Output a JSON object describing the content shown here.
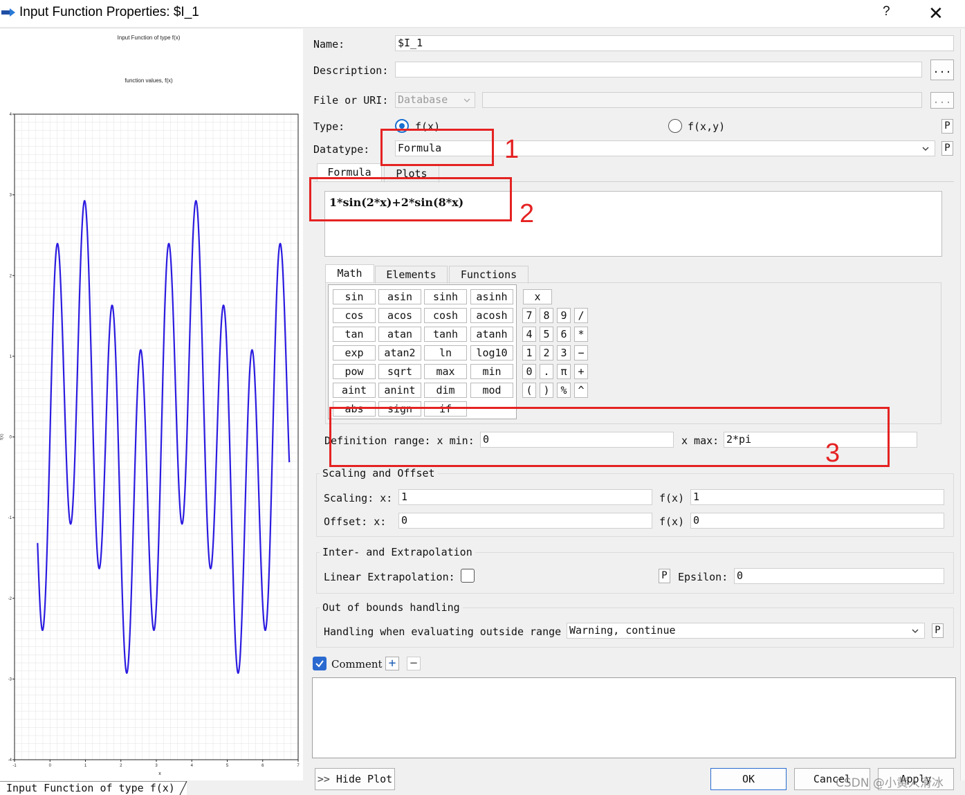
{
  "window": {
    "title": "Input Function Properties: $I_1",
    "help_label": "?",
    "close_label": "✕"
  },
  "plot": {
    "title": "Input Function of type f(x)",
    "subtitle": "function values, f(x)",
    "xlabel": "x",
    "ylabel": "f(x)",
    "bottom_tab": "Input Function of type f(x)",
    "line_color": "#2b1be0"
  },
  "chart_data": {
    "type": "line",
    "title": "Input Function of type f(x)",
    "subtitle": "function values, f(x)",
    "xlabel": "x",
    "ylabel": "f(x)",
    "function": "1*sin(2*x)+2*sin(8*x)",
    "xlim": [
      -1,
      7
    ],
    "ylim": [
      -4,
      4
    ],
    "x_ticks": [
      -1,
      0,
      1,
      2,
      3,
      4,
      5,
      6,
      7
    ],
    "y_ticks": [
      -4,
      -3,
      -2,
      -1,
      0,
      1,
      2,
      3,
      4
    ],
    "x_range": [
      -0.35,
      6.75
    ],
    "grid": true,
    "series": [
      {
        "color": "#2b1be0"
      }
    ]
  },
  "form": {
    "name_label": "Name:",
    "name_value": "$I_1",
    "description_label": "Description:",
    "description_value": "",
    "description_btn": "...",
    "file_label": "File or URI:",
    "file_source": "Database",
    "file_btn": "...",
    "type_label": "Type:",
    "type_fx": "f(x)",
    "type_fxy": "f(x,y)",
    "p_label": "P",
    "datatype_label": "Datatype:",
    "datatype_value": "Formula"
  },
  "tabs": {
    "formula": "Formula",
    "plots": "Plots"
  },
  "formula_value": "1*sin(2*x)+2*sin(8*x)",
  "keypad": {
    "tabs": [
      "Math",
      "Elements",
      "Functions"
    ],
    "funcs": [
      [
        "sin",
        "asin",
        "sinh",
        "asinh"
      ],
      [
        "cos",
        "acos",
        "cosh",
        "acosh"
      ],
      [
        "tan",
        "atan",
        "tanh",
        "atanh"
      ],
      [
        "exp",
        "atan2",
        "ln",
        "log10"
      ],
      [
        "pow",
        "sqrt",
        "max",
        "min"
      ],
      [
        "aint",
        "anint",
        "dim",
        "mod"
      ],
      [
        "abs",
        "sign",
        "if",
        ""
      ]
    ],
    "var_x": "x",
    "nums": [
      [
        "7",
        "8",
        "9",
        "/"
      ],
      [
        "4",
        "5",
        "6",
        "*"
      ],
      [
        "1",
        "2",
        "3",
        "−"
      ],
      [
        "0",
        ".",
        "π",
        "+"
      ],
      [
        "(",
        ")",
        "%",
        "^"
      ]
    ]
  },
  "range": {
    "label": "Definition range: x min:",
    "xmin": "0",
    "xmax_label": "x max:",
    "xmax": "2*pi"
  },
  "scaling": {
    "group": "Scaling and Offset",
    "scaling_label": "Scaling: x:",
    "scaling_x": "1",
    "fx_label": "f(x)",
    "scaling_fx": "1",
    "offset_label": "Offset: x:",
    "offset_x": "0",
    "offset_fx": "0"
  },
  "interp": {
    "group": "Inter- and Extrapolation",
    "linear_label": "Linear Extrapolation:",
    "epsilon_label": "Epsilon:",
    "epsilon_value": "0"
  },
  "bounds": {
    "group": "Out of bounds handling",
    "label": "Handling when evaluating outside range",
    "value": "Warning, continue"
  },
  "comment": {
    "label": "Comment",
    "add": "+",
    "remove": "−",
    "text": ""
  },
  "footer": {
    "hide_plot": "Hide Plot",
    "ok": "OK",
    "cancel": "Cancel",
    "apply": "Apply"
  },
  "annotations": {
    "n1": "1",
    "n2": "2",
    "n3": "3",
    "color": "#e52222"
  },
  "watermark": "CSDN @小黄人滑冰"
}
